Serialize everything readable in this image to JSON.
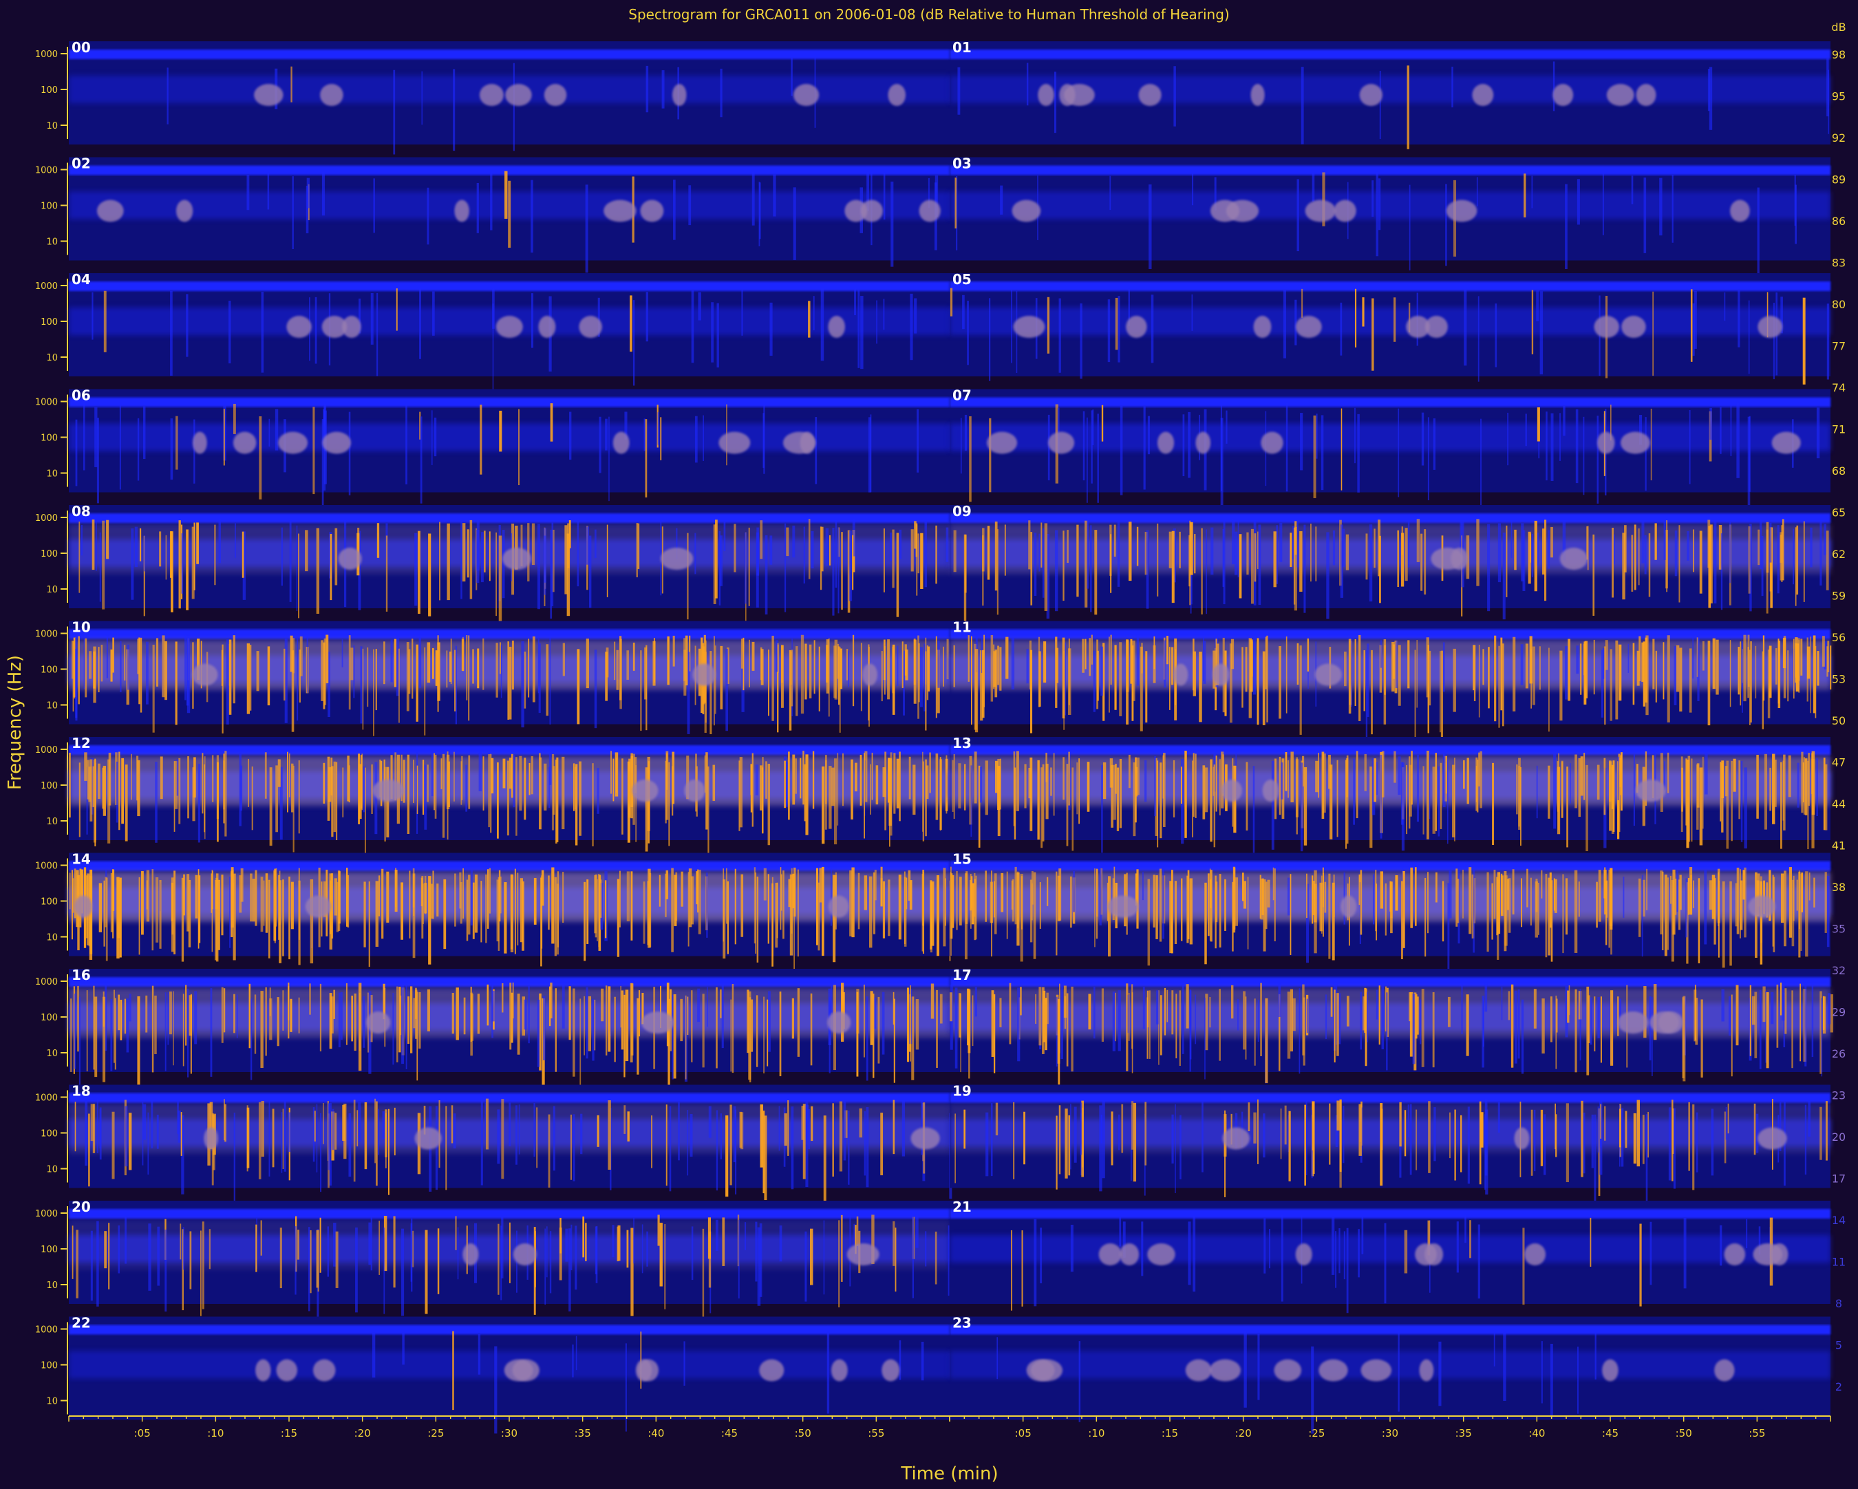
{
  "chart_data": {
    "type": "heatmap",
    "title": "Spectrogram for GRCA011 on 2006-01-08 (dB Relative to Human Threshold of Hearing)",
    "xlabel": "Time (min)",
    "ylabel": "Frequency (Hz)",
    "y_tick_labels": [
      "1000",
      "100",
      "10"
    ],
    "x_tick_labels": [
      ":05",
      ":10",
      ":15",
      ":20",
      ":25",
      ":30",
      ":35",
      ":40",
      ":45",
      ":50",
      ":55"
    ],
    "hours": [
      "00",
      "01",
      "02",
      "03",
      "04",
      "05",
      "06",
      "07",
      "08",
      "09",
      "10",
      "11",
      "12",
      "13",
      "14",
      "15",
      "16",
      "17",
      "18",
      "19",
      "20",
      "21",
      "22",
      "23"
    ],
    "activity_by_hour": [
      0.05,
      0.05,
      0.12,
      0.12,
      0.15,
      0.18,
      0.2,
      0.25,
      0.55,
      0.65,
      0.85,
      0.85,
      0.88,
      0.88,
      0.95,
      0.95,
      0.75,
      0.72,
      0.55,
      0.5,
      0.45,
      0.15,
      0.05,
      0.05
    ],
    "colorbar_label": "dB",
    "colorbar_ticks": [
      "98",
      "95",
      "92",
      "89",
      "86",
      "83",
      "80",
      "77",
      "74",
      "71",
      "68",
      "65",
      "62",
      "59",
      "56",
      "53",
      "50",
      "47",
      "44",
      "41",
      "38",
      "35",
      "32",
      "29",
      "26",
      "23",
      "20",
      "17",
      "14",
      "11",
      "8",
      "5",
      "2"
    ],
    "colors": {
      "background": "#14082e",
      "panel": "#0d0f7a",
      "band": "#1e28ff",
      "hot": "#ffa51e",
      "mid": "#9a7fb0",
      "axis": "#f2d43a"
    }
  }
}
